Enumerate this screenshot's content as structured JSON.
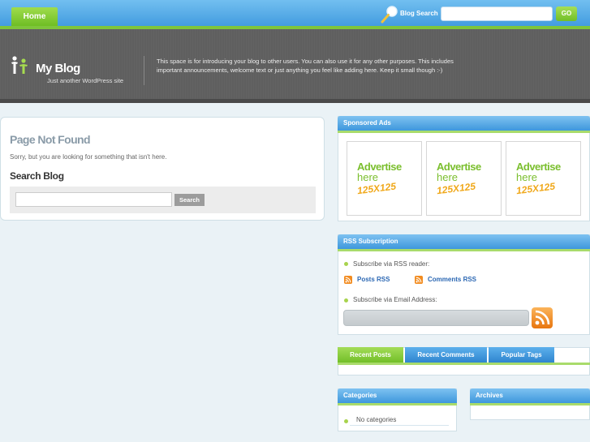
{
  "nav": {
    "home_label": "Home"
  },
  "top_search": {
    "label": "Blog Search",
    "button_label": "GO"
  },
  "header": {
    "site_title": "My Blog",
    "tagline": "Just another WordPress site",
    "intro": "This space is for introducing your blog to other users. You can also use it for any other purposes. This includes important announcements, welcome text or just anything you feel like adding here. Keep it small though :-)"
  },
  "main": {
    "title": "Page Not Found",
    "message": "Sorry, but you are looking for something that isn't here.",
    "search_heading": "Search Blog",
    "search_button_label": "Search"
  },
  "sidebar": {
    "sponsored": {
      "title": "Sponsored Ads",
      "ads": [
        {
          "line1": "Advertise",
          "line2": "here",
          "size": "125X125"
        },
        {
          "line1": "Advertise",
          "line2": "here",
          "size": "125X125"
        },
        {
          "line1": "Advertise",
          "line2": "here",
          "size": "125X125"
        }
      ]
    },
    "rss": {
      "title": "RSS Subscription",
      "reader_label": "Subscribe via RSS reader:",
      "posts_rss": "Posts RSS",
      "comments_rss": "Comments RSS",
      "email_label": "Subscribe via Email Address:"
    },
    "tabs": [
      {
        "label": "Recent Posts",
        "active": true
      },
      {
        "label": "Recent Comments",
        "active": false
      },
      {
        "label": "Popular Tags",
        "active": false
      }
    ],
    "categories": {
      "title": "Categories",
      "items": [
        "No categories"
      ]
    },
    "archives": {
      "title": "Archives"
    }
  },
  "colors": {
    "nav_blue": "#3d98dd",
    "accent_green": "#7ec53b",
    "header_gray": "#5f5f5f",
    "rss_orange": "#f28c21",
    "link_blue": "#2b67b3"
  }
}
